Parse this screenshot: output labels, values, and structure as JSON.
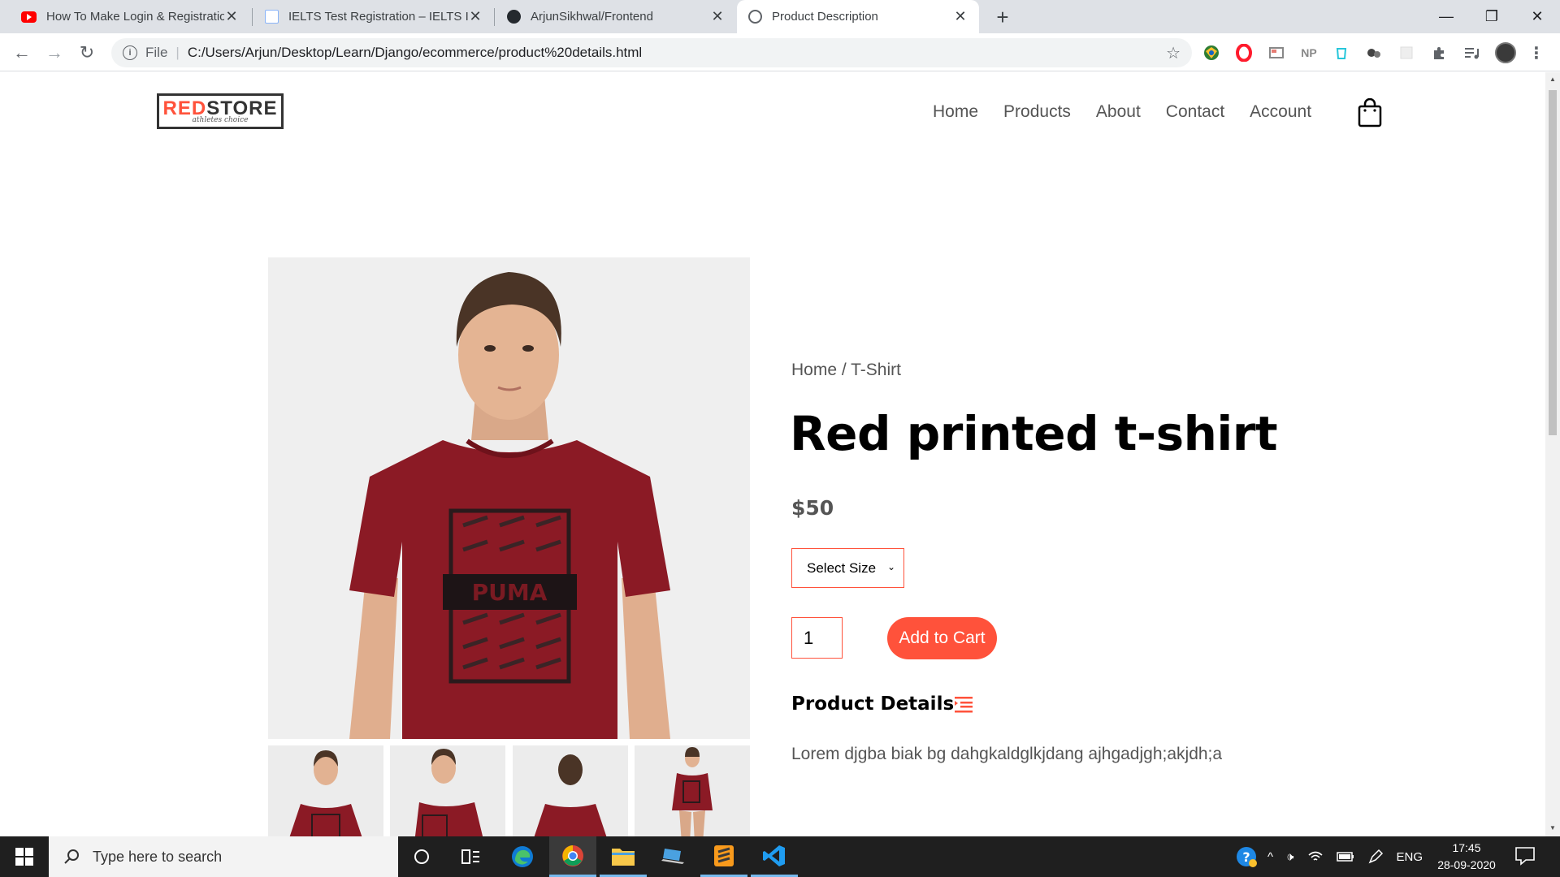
{
  "browser": {
    "tabs": [
      {
        "title": "How To Make Login & Registratio",
        "icon": "youtube-icon"
      },
      {
        "title": "IELTS Test Registration – IELTS IDP",
        "icon": "document-icon"
      },
      {
        "title": "ArjunSikhwal/Frontend",
        "icon": "github-icon"
      },
      {
        "title": "Product Description",
        "icon": "globe-icon"
      }
    ],
    "address": {
      "scheme_label": "File",
      "url": "C:/Users/Arjun/Desktop/Learn/Django/ecommerce/product%20details.html"
    },
    "extensions": [
      "NP"
    ]
  },
  "site": {
    "logo": {
      "brand_red": "RED",
      "brand_dark": "STORE",
      "tagline": "athletes choice"
    },
    "nav": [
      "Home",
      "Products",
      "About",
      "Contact",
      "Account"
    ]
  },
  "product": {
    "breadcrumb": "Home / T-Shirt",
    "title": "Red printed t-shirt",
    "price": "$50",
    "size_select": "Select Size",
    "quantity": "1",
    "add_to_cart": "Add to Cart",
    "details_heading": "Product Details",
    "description": "Lorem djgba biak bg dahgkaldglkjdang ajhgadjgh;akjdh;a"
  },
  "taskbar": {
    "search_placeholder": "Type here to search",
    "language": "ENG",
    "time": "17:45",
    "date": "28-09-2020"
  },
  "colors": {
    "accent": "#ff523b",
    "shirt": "#8b1a25"
  }
}
